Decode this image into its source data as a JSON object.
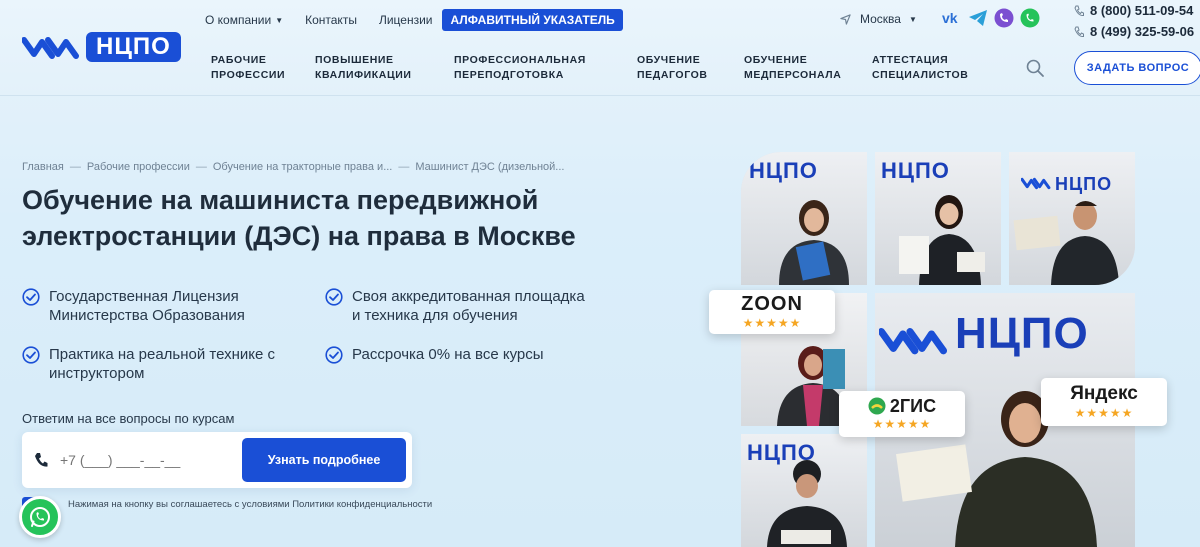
{
  "brand": {
    "logo_text": "НЦПО",
    "accent": "#1a4fd6"
  },
  "topnav": {
    "about": "О компании",
    "contacts": "Контакты",
    "licenses": "Лицензии",
    "alphabet": "АЛФАВИТНЫЙ УКАЗАТЕЛЬ"
  },
  "city": "Москва",
  "socials": [
    "vk-icon",
    "telegram-icon",
    "viber-icon",
    "whatsapp-icon"
  ],
  "phones": [
    "8 (800) 511-09-54",
    "8 (499) 325-59-06"
  ],
  "mainnav": [
    {
      "label": "Рабочие\nпрофессии"
    },
    {
      "label": "Повышение\nквалификации"
    },
    {
      "label": "Профессиональная\nпереподготовка"
    },
    {
      "label": "Обучение\nпедагогов"
    },
    {
      "label": "Обучение\nмедперсонала"
    },
    {
      "label": "Аттестация\nспециалистов"
    }
  ],
  "ask_button": "ЗАДАТЬ ВОПРОС",
  "breadcrumbs": [
    "Главная",
    "Рабочие профессии",
    "Обучение на тракторные права и...",
    "Машинист ДЭС (дизельной..."
  ],
  "breadcrumb_sep": "—",
  "title": "Обучение на машиниста передвижной электростанции (ДЭС) на права в Москве",
  "features": [
    "Государственная Лицензия\nМинистерства Образования",
    "Своя аккредитованная площадка\nи техника для обучения",
    "Практика на реальной технике с\nинструктором",
    "Рассрочка 0% на все курсы"
  ],
  "form": {
    "title": "Ответим на все вопросы по курсам",
    "phone_placeholder": "+7 (___) ___-__-__",
    "submit": "Узнать подробнее",
    "consent": "Нажимая на кнопку вы соглашаетесь с условиями Политики конфиденциальности"
  },
  "badges": {
    "zoon": "ZOON",
    "gis": "2ГИС",
    "yandex": "Яндекс",
    "stars": "★★★★★"
  },
  "wall_logo": "НЦПО"
}
